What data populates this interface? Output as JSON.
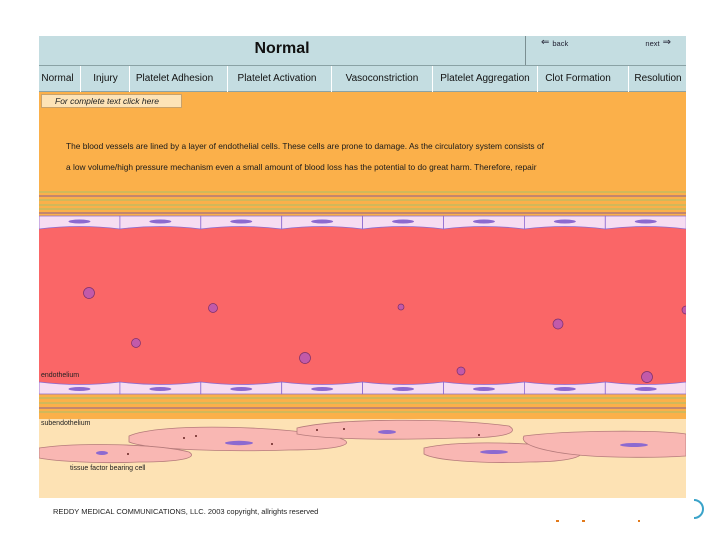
{
  "header": {
    "title": "Normal",
    "back_label": "back",
    "next_label": "next"
  },
  "tabs": [
    {
      "label": "Normal"
    },
    {
      "label": "Injury"
    },
    {
      "label": "Platelet Adhesion"
    },
    {
      "label": "Platelet Activation"
    },
    {
      "label": "Vasoconstriction"
    },
    {
      "label": "Platelet Aggregation"
    },
    {
      "label": "Clot Formation"
    },
    {
      "label": "Resolution"
    }
  ],
  "link": {
    "full_text": "For complete text click here"
  },
  "content": {
    "line1": "The blood vessels are lined by a layer of endothelial cells.  These cells are  prone to damage. As the circulatory system consists of",
    "line2": "a low volume/high pressure mechanism even a small amount of blood loss has the potential to do great harm.  Therefore, repair"
  },
  "diagram": {
    "endothelium_label": "endothelium",
    "subendothelium_label": "subendothelium",
    "tissue_cell_label": "tissue factor bearing cell",
    "colors": {
      "lumen": "#fa6667",
      "endothelial_cell": "#f6ddf2",
      "nucleus": "#8c6ad0",
      "platelet": "#c25aa9",
      "tissue_cell": "#f9b7b3",
      "subendothelium": "#fde2b4",
      "stripe_green": "#a7c16a",
      "stripe_purple": "#8a5b93"
    }
  },
  "footer": {
    "copyright": "REDDY MEDICAL COMMUNICATIONS, LLC. 2003 copyright, allrights reserved"
  },
  "icons": {
    "back": "arrow-left-icon",
    "next": "arrow-right-icon",
    "nav_arc": "arc-icon"
  }
}
